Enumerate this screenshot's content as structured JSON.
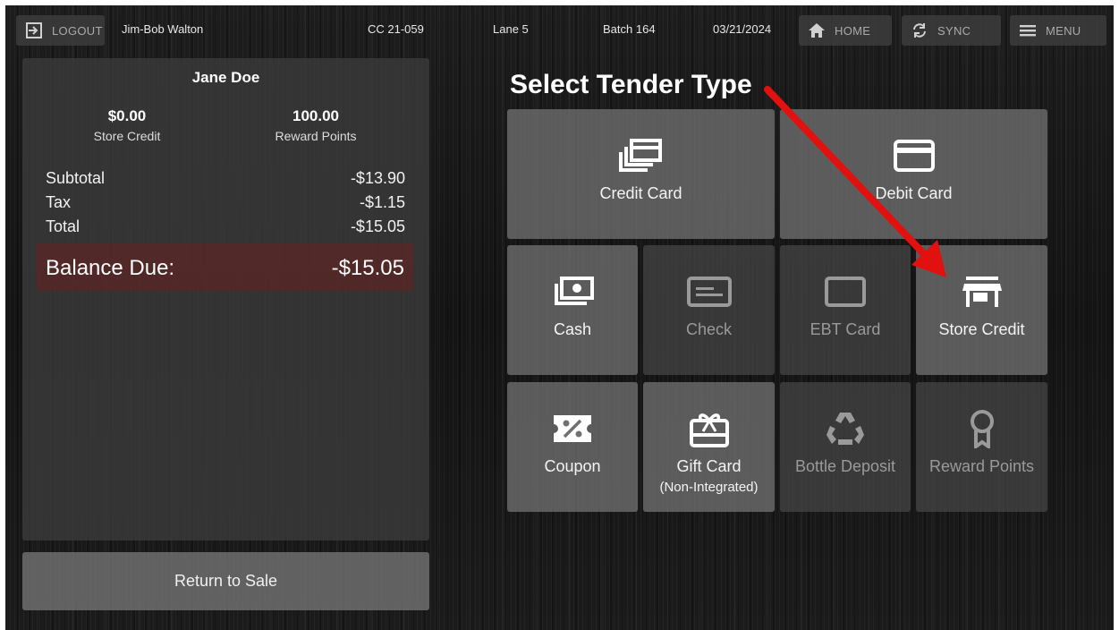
{
  "topbar": {
    "logout_label": "LOGOUT",
    "cashier": "Jim-Bob Walton",
    "register": "CC 21-059",
    "lane": "Lane 5",
    "batch": "Batch 164",
    "date": "03/21/2024",
    "home_label": "HOME",
    "sync_label": "SYNC",
    "menu_label": "MENU",
    "icons": {
      "logout": "logout-icon",
      "home": "home-icon",
      "sync": "sync-icon",
      "menu": "hamburger-menu-icon"
    }
  },
  "customer": {
    "name": "Jane Doe",
    "store_credit_value": "$0.00",
    "store_credit_label": "Store Credit",
    "reward_points_value": "100.00",
    "reward_points_label": "Reward Points"
  },
  "totals": {
    "subtotal_label": "Subtotal",
    "subtotal_value": "-$13.90",
    "tax_label": "Tax",
    "tax_value": "-$1.15",
    "total_label": "Total",
    "total_value": "-$15.05",
    "balance_label": "Balance Due:",
    "balance_value": "-$15.05",
    "balance_color": "#5c2626"
  },
  "return_button": "Return to Sale",
  "tender": {
    "title": "Select Tender Type",
    "credit_card": {
      "label": "Credit Card",
      "icon": "credit-card-stack-icon",
      "enabled": true
    },
    "debit_card": {
      "label": "Debit Card",
      "icon": "debit-card-icon",
      "enabled": true
    },
    "cash": {
      "label": "Cash",
      "icon": "cash-icon",
      "enabled": true
    },
    "check": {
      "label": "Check",
      "icon": "check-icon",
      "enabled": false
    },
    "ebt_card": {
      "label": "EBT Card",
      "icon": "ebt-card-icon",
      "enabled": false
    },
    "store_credit": {
      "label": "Store Credit",
      "icon": "storefront-icon",
      "enabled": true
    },
    "coupon": {
      "label": "Coupon",
      "icon": "coupon-percent-icon",
      "enabled": true
    },
    "gift_card": {
      "label": "Gift Card",
      "sublabel": "(Non-Integrated)",
      "icon": "gift-card-icon",
      "enabled": true
    },
    "bottle_deposit": {
      "label": "Bottle Deposit",
      "icon": "recycle-icon",
      "enabled": false
    },
    "reward_points": {
      "label": "Reward Points",
      "icon": "award-ribbon-icon",
      "enabled": false
    }
  },
  "annotation": {
    "arrow_color": "#e0110f",
    "icon": "red-arrow-annotation"
  }
}
